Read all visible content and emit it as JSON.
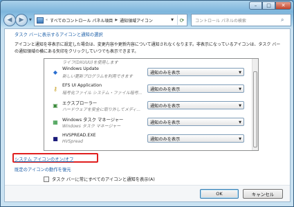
{
  "breadcrumb": {
    "items": [
      "すべてのコントロール パネル項目",
      "通知領域アイコン"
    ]
  },
  "search": {
    "placeholder": "コントロール パネルの検索"
  },
  "main": {
    "heading": "タスク バーに表示するアイコンと通知の選択",
    "description": "アイコンと通知を非表示に設定した場合は、変更内容や更新内容について通知されなくなります。非表示になっているアイコンは、タスク バーの通知領域の横にある矢印をクリックしていつでも表示できます。"
  },
  "icon_list": {
    "cut_item_text": "ライフ(DXUUU)を使用します",
    "rows": [
      {
        "name": "Windows Update",
        "subtitle": "新しい更新プログラムを利用できます",
        "behavior": "通知のみを表示",
        "icon": "shield-icon"
      },
      {
        "name": "EFS UI Application",
        "subtitle": "暗号化ファイル システム・ファイル暗号...",
        "behavior": "通知のみを表示",
        "icon": "key-icon"
      },
      {
        "name": "エクスプローラー",
        "subtitle": "ハードウェアを安全に取り外してメディ...",
        "behavior": "通知のみを表示",
        "icon": "usb-device-icon"
      },
      {
        "name": "Windows タスク マネージャー",
        "subtitle": "Windows タスク マネージャー",
        "behavior": "通知のみを表示",
        "icon": "task-manager-icon"
      },
      {
        "name": "HVSPREAD.EXE",
        "subtitle": "HVSpread",
        "behavior": "通知のみを表示",
        "icon": "hvspread-icon"
      }
    ]
  },
  "links": {
    "system_icons": "システム アイコンのオン/オフ",
    "restore_defaults": "既定のアイコンの動作を復元"
  },
  "checkbox": {
    "label": "タスク バーに常にすべてのアイコンと通知を表示(A)",
    "checked": false
  },
  "buttons": {
    "ok": "OK",
    "cancel": "キャンセル"
  },
  "colors": {
    "link": "#1c5fa8",
    "highlight": "#e01e1e"
  }
}
